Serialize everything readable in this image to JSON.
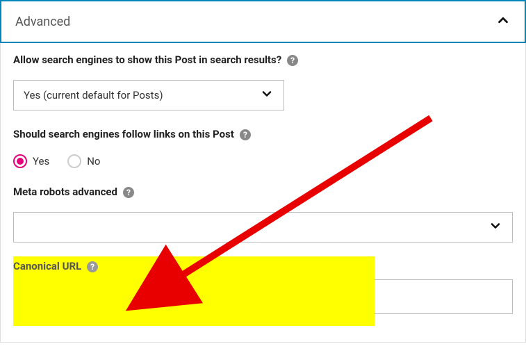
{
  "accordion": {
    "title": "Advanced"
  },
  "searchResults": {
    "label": "Allow search engines to show this Post in search results?",
    "selected": "Yes (current default for Posts)"
  },
  "followLinks": {
    "label": "Should search engines follow links on this Post",
    "options": {
      "yes": "Yes",
      "no": "No"
    },
    "value": "yes"
  },
  "metaRobots": {
    "label": "Meta robots advanced",
    "selected": ""
  },
  "canonical": {
    "label": "Canonical URL",
    "value": ""
  },
  "help_glyph": "?"
}
